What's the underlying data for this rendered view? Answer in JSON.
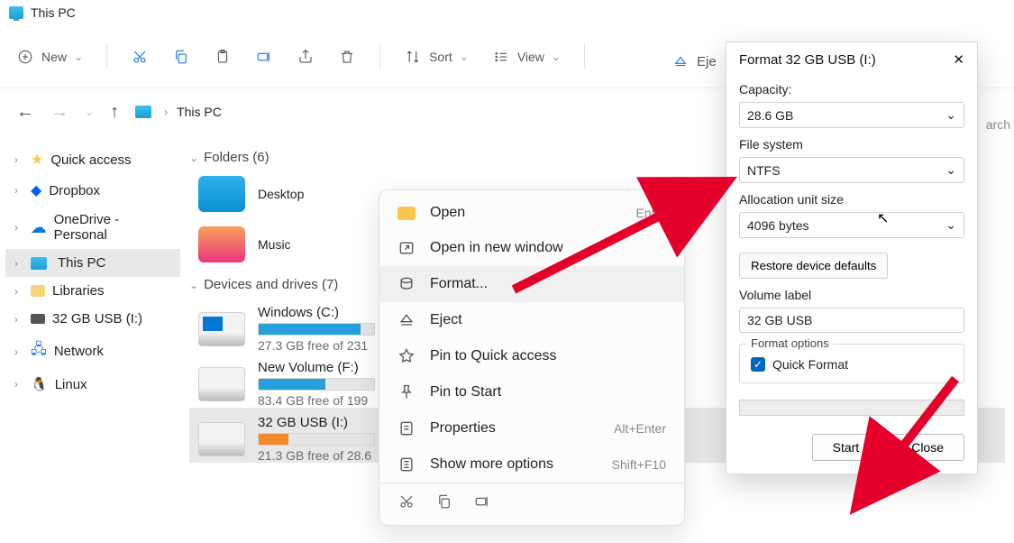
{
  "titlebar": {
    "title": "This PC"
  },
  "toolbar": {
    "new": "New",
    "sort": "Sort",
    "view": "View",
    "eject": "Eje"
  },
  "nav": {
    "path": "This PC"
  },
  "sidebar": {
    "quick": "Quick access",
    "dropbox": "Dropbox",
    "onedrive": "OneDrive - Personal",
    "thispc": "This PC",
    "libraries": "Libraries",
    "usb": "32 GB USB (I:)",
    "network": "Network",
    "linux": "Linux"
  },
  "content": {
    "folders_header": "Folders (6)",
    "desktop": "Desktop",
    "music": "Music",
    "drives_header": "Devices and drives (7)",
    "drive1": {
      "name": "Windows (C:)",
      "sub": "27.3 GB free of 231"
    },
    "drive2": {
      "name": "New Volume (F:)",
      "sub": "83.4 GB free of 199"
    },
    "drive3": {
      "name": "32 GB USB (I:)",
      "sub": "21.3 GB free of 28.6"
    }
  },
  "ctx": {
    "open": "Open",
    "open_kbd": "Enter",
    "open_new": "Open in new window",
    "format": "Format...",
    "eject": "Eject",
    "pin_quick": "Pin to Quick access",
    "pin_start": "Pin to Start",
    "properties": "Properties",
    "properties_kbd": "Alt+Enter",
    "more": "Show more options",
    "more_kbd": "Shift+F10"
  },
  "dialog": {
    "title": "Format 32 GB USB (I:)",
    "capacity_label": "Capacity:",
    "capacity_value": "28.6 GB",
    "filesystem_label": "File system",
    "filesystem_value": "NTFS",
    "alloc_label": "Allocation unit size",
    "alloc_value": "4096 bytes",
    "restore": "Restore device defaults",
    "volume_label": "Volume label",
    "volume_value": "32 GB USB",
    "format_options": "Format options",
    "quick_format": "Quick Format",
    "start": "Start",
    "close": "Close"
  },
  "search_hint": "arch"
}
